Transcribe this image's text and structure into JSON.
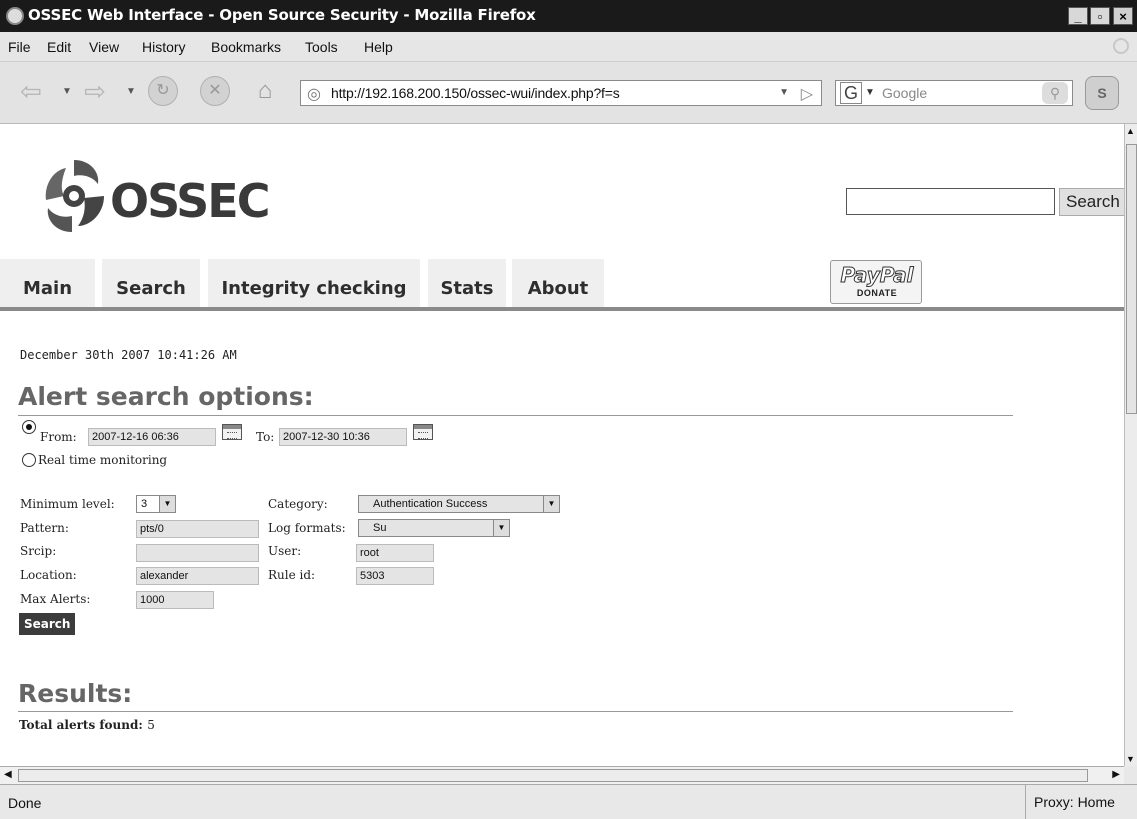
{
  "window": {
    "title": "OSSEC Web Interface - Open Source Security - Mozilla Firefox",
    "controls": {
      "minimize": "_",
      "maximize": "▫",
      "close": "×"
    }
  },
  "menu": [
    "File",
    "Edit",
    "View",
    "History",
    "Bookmarks",
    "Tools",
    "Help"
  ],
  "toolbar": {
    "url": "http://192.168.200.150/ossec-wui/index.php?f=s",
    "search_placeholder": "Google",
    "search_engine_glyph": "G",
    "icons": [
      "back-icon",
      "forward-icon",
      "reload-icon",
      "stop-icon",
      "home-icon",
      "site-icon",
      "go-icon",
      "magnifier-icon",
      "sync-icon"
    ]
  },
  "page": {
    "logo_text": "OSSEC",
    "site_search": {
      "value": "",
      "button": "Search"
    },
    "tabs": [
      "Main",
      "Search",
      "Integrity checking",
      "Stats",
      "About"
    ],
    "paypal": {
      "brand": "PayPal",
      "sub": "DONATE"
    },
    "timestamp": "December 30th 2007 10:41:26 AM",
    "alert_section_title": "Alert search options:",
    "range": {
      "from_label": "From:",
      "from_value": "2007-12-16 06:36",
      "to_label": "To:",
      "to_value": "2007-12-30 10:36",
      "realtime_label": "Real time monitoring",
      "selected": "from"
    },
    "filters": {
      "min_level_label": "Minimum level:",
      "min_level_value": "3",
      "category_label": "Category:",
      "category_value": "Authentication Success",
      "pattern_label": "Pattern:",
      "pattern_value": "pts/0",
      "log_formats_label": "Log formats:",
      "log_formats_value": "Su",
      "srcip_label": "Srcip:",
      "srcip_value": "",
      "user_label": "User:",
      "user_value": "root",
      "location_label": "Location:",
      "location_value": "alexander",
      "rule_id_label": "Rule id:",
      "rule_id_value": "5303",
      "max_alerts_label": "Max Alerts:",
      "max_alerts_value": "1000"
    },
    "search_button": "Search",
    "results_title": "Results:",
    "total_label": "Total alerts found:",
    "total_value": "5"
  },
  "status": {
    "text": "Done",
    "proxy": "Proxy: Home"
  }
}
